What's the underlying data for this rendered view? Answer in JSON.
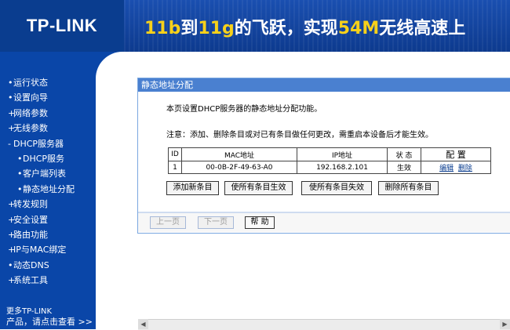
{
  "header": {
    "logo": "TP-LINK",
    "slogan": [
      "11b",
      "到",
      "11g",
      "的飞跃，实现",
      "54M",
      "无线高速上"
    ]
  },
  "sidebar": {
    "items": [
      {
        "label": "运行状态"
      },
      {
        "label": "设置向导"
      },
      {
        "label": "网络参数"
      },
      {
        "label": "无线参数"
      },
      {
        "label": "DHCP服务器"
      },
      {
        "label": "DHCP服务"
      },
      {
        "label": "客户端列表"
      },
      {
        "label": "静态地址分配"
      },
      {
        "label": "转发规则"
      },
      {
        "label": "安全设置"
      },
      {
        "label": "路由功能"
      },
      {
        "label": "IP与MAC绑定"
      },
      {
        "label": "动态DNS"
      },
      {
        "label": "系统工具"
      }
    ],
    "more_line1": "更多TP-LINK",
    "more_line2": "产品，请点击查看 >>"
  },
  "panel": {
    "title": "静态地址分配",
    "description": "本页设置DHCP服务器的静态地址分配功能。",
    "note": "注意：添加、删除条目或对已有条目做任何更改，需重启本设备后才能生效。",
    "table": {
      "headers": [
        "ID",
        "MAC地址",
        "IP地址",
        "状 态",
        "配 置"
      ],
      "rows": [
        {
          "id": "1",
          "mac": "00-0B-2F-49-63-A0",
          "ip": "192.168.2.101",
          "status": "生效",
          "edit": "编辑",
          "delete": "删除"
        }
      ]
    },
    "buttons": {
      "add": "添加新条目",
      "enable_all": "使所有条目生效",
      "disable_all": "使所有条目失效",
      "delete_all": "删除所有条目"
    },
    "nav": {
      "prev": "上一页",
      "next": "下一页",
      "help": "帮 助"
    }
  },
  "colors": {
    "brand_blue": "#0a46a8",
    "panel_title": "#4a80d0",
    "slogan_accent": "#f7d11a"
  }
}
